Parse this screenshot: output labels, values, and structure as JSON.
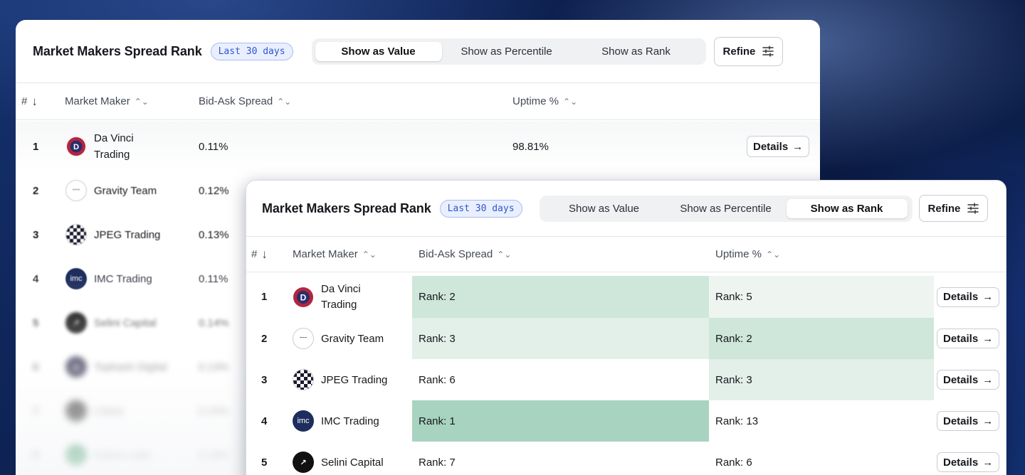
{
  "title": "Market Makers Spread Rank",
  "period": "Last 30 days",
  "segments": [
    "Show as Value",
    "Show as Percentile",
    "Show as Rank"
  ],
  "refine_label": "Refine",
  "columns": {
    "rank": "#",
    "market_maker": "Market Maker",
    "spread": "Bid-Ask Spread",
    "uptime": "Uptime %"
  },
  "details_label": "Details",
  "colors": {
    "accent": "#2f57c8",
    "rank_strong": "#a7d3c0",
    "rank_mid": "#cfe6da",
    "rank_light": "#e3efe9"
  },
  "value_view": {
    "active_segment": "Show as Value",
    "rows": [
      {
        "rank": "1",
        "name": "Da Vinci Trading",
        "spread": "0.11%",
        "uptime": "98.81%",
        "logo_icon": "da-vinci-logo"
      },
      {
        "rank": "2",
        "name": "Gravity Team",
        "spread": "0.12%",
        "logo_icon": "gravity-team-logo"
      },
      {
        "rank": "3",
        "name": "JPEG Trading",
        "spread": "0.13%",
        "logo_icon": "jpeg-trading-logo"
      },
      {
        "rank": "4",
        "name": "IMC Trading",
        "spread": "0.11%",
        "logo_icon": "imc-logo"
      },
      {
        "rank": "5",
        "name": "Selini Capital",
        "spread": "0.14%",
        "logo_icon": "selini-logo"
      },
      {
        "rank": "6",
        "name": "Tophash Digital",
        "spread": "0.13%",
        "logo_icon": "tophash-logo"
      },
      {
        "rank": "7",
        "name": "Lhava",
        "spread": "0.24%",
        "logo_icon": "lhava-logo"
      },
      {
        "rank": "8",
        "name": "Kairon Labs",
        "spread": "0.18%",
        "logo_icon": "kairon-logo"
      }
    ]
  },
  "rank_view": {
    "active_segment": "Show as Rank",
    "rows": [
      {
        "rank": "1",
        "name": "Da Vinci Trading",
        "spread": "Rank: 2",
        "uptime": "Rank: 5"
      },
      {
        "rank": "2",
        "name": "Gravity Team",
        "spread": "Rank: 3",
        "uptime": "Rank: 2"
      },
      {
        "rank": "3",
        "name": "JPEG Trading",
        "spread": "Rank: 6",
        "uptime": "Rank: 3"
      },
      {
        "rank": "4",
        "name": "IMC Trading",
        "spread": "Rank: 1",
        "uptime": "Rank: 13"
      },
      {
        "rank": "5",
        "name": "Selini Capital",
        "spread": "Rank: 7",
        "uptime": "Rank: 6"
      }
    ]
  }
}
